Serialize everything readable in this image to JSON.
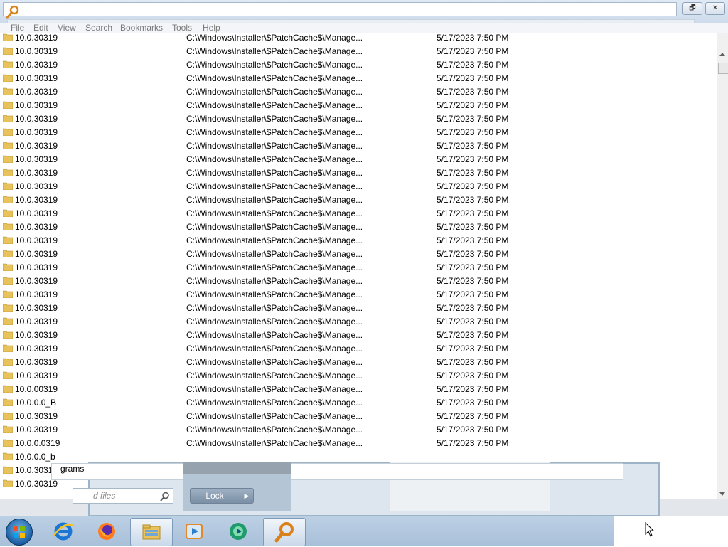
{
  "window": {
    "controls": {
      "restore_label": "🗗",
      "close_label": "✕"
    }
  },
  "menu": [
    {
      "label": "File"
    },
    {
      "label": "Edit"
    },
    {
      "label": "View"
    },
    {
      "label": "Search"
    },
    {
      "label": "Bookmarks"
    },
    {
      "label": "Tools"
    },
    {
      "label": "Help"
    }
  ],
  "rows": [
    {
      "name": "10.0.30319",
      "path": "C:\\Windows\\Installer\\$PatchCache$\\Manage...",
      "date": "5/17/2023 7:50 PM"
    },
    {
      "name": "10.0.30319",
      "path": "C:\\Windows\\Installer\\$PatchCache$\\Manage...",
      "date": "5/17/2023 7:50 PM"
    },
    {
      "name": "10.0.30319",
      "path": "C:\\Windows\\Installer\\$PatchCache$\\Manage...",
      "date": "5/17/2023 7:50 PM"
    },
    {
      "name": "10.0.30319",
      "path": "C:\\Windows\\Installer\\$PatchCache$\\Manage...",
      "date": "5/17/2023 7:50 PM"
    },
    {
      "name": "10.0.30319",
      "path": "C:\\Windows\\Installer\\$PatchCache$\\Manage...",
      "date": "5/17/2023 7:50 PM"
    },
    {
      "name": "10.0.30319",
      "path": "C:\\Windows\\Installer\\$PatchCache$\\Manage...",
      "date": "5/17/2023 7:50 PM"
    },
    {
      "name": "10.0.30319",
      "path": "C:\\Windows\\Installer\\$PatchCache$\\Manage...",
      "date": "5/17/2023 7:50 PM"
    },
    {
      "name": "10.0.30319",
      "path": "C:\\Windows\\Installer\\$PatchCache$\\Manage...",
      "date": "5/17/2023 7:50 PM"
    },
    {
      "name": "10.0.30319",
      "path": "C:\\Windows\\Installer\\$PatchCache$\\Manage...",
      "date": "5/17/2023 7:50 PM"
    },
    {
      "name": "10.0.30319",
      "path": "C:\\Windows\\Installer\\$PatchCache$\\Manage...",
      "date": "5/17/2023 7:50 PM"
    },
    {
      "name": "10.0.30319",
      "path": "C:\\Windows\\Installer\\$PatchCache$\\Manage...",
      "date": "5/17/2023 7:50 PM"
    },
    {
      "name": "10.0.30319",
      "path": "C:\\Windows\\Installer\\$PatchCache$\\Manage...",
      "date": "5/17/2023 7:50 PM"
    },
    {
      "name": "10.0.30319",
      "path": "C:\\Windows\\Installer\\$PatchCache$\\Manage...",
      "date": "5/17/2023 7:50 PM"
    },
    {
      "name": "10.0.30319",
      "path": "C:\\Windows\\Installer\\$PatchCache$\\Manage...",
      "date": "5/17/2023 7:50 PM"
    },
    {
      "name": "10.0.30319",
      "path": "C:\\Windows\\Installer\\$PatchCache$\\Manage...",
      "date": "5/17/2023 7:50 PM"
    },
    {
      "name": "10.0.30319",
      "path": "C:\\Windows\\Installer\\$PatchCache$\\Manage...",
      "date": "5/17/2023 7:50 PM"
    },
    {
      "name": "10.0.30319",
      "path": "C:\\Windows\\Installer\\$PatchCache$\\Manage...",
      "date": "5/17/2023 7:50 PM"
    },
    {
      "name": "10.0.30319",
      "path": "C:\\Windows\\Installer\\$PatchCache$\\Manage...",
      "date": "5/17/2023 7:50 PM"
    },
    {
      "name": "10.0.30319",
      "path": "C:\\Windows\\Installer\\$PatchCache$\\Manage...",
      "date": "5/17/2023 7:50 PM"
    },
    {
      "name": "10.0.30319",
      "path": "C:\\Windows\\Installer\\$PatchCache$\\Manage...",
      "date": "5/17/2023 7:50 PM"
    },
    {
      "name": "10.0.30319",
      "path": "C:\\Windows\\Installer\\$PatchCache$\\Manage...",
      "date": "5/17/2023 7:50 PM"
    },
    {
      "name": "10.0.30319",
      "path": "C:\\Windows\\Installer\\$PatchCache$\\Manage...",
      "date": "5/17/2023 7:50 PM"
    },
    {
      "name": "10.0.30319",
      "path": "C:\\Windows\\Installer\\$PatchCache$\\Manage...",
      "date": "5/17/2023 7:50 PM"
    },
    {
      "name": "10.0.30319",
      "path": "C:\\Windows\\Installer\\$PatchCache$\\Manage...",
      "date": "5/17/2023 7:50 PM"
    },
    {
      "name": "10.0.30319",
      "path": "C:\\Windows\\Installer\\$PatchCache$\\Manage...",
      "date": "5/17/2023 7:50 PM"
    },
    {
      "name": "10.0.30319",
      "path": "C:\\Windows\\Installer\\$PatchCache$\\Manage...",
      "date": "5/17/2023 7:50 PM"
    },
    {
      "name": "10.0.00319",
      "path": "C:\\Windows\\Installer\\$PatchCache$\\Manage...",
      "date": "5/17/2023 7:50 PM"
    },
    {
      "name": "10.0.0.0_B",
      "path": "C:\\Windows\\Installer\\$PatchCache$\\Manage...",
      "date": "5/17/2023 7:50 PM"
    },
    {
      "name": "10.0.30319",
      "path": "C:\\Windows\\Installer\\$PatchCache$\\Manage...",
      "date": "5/17/2023 7:50 PM"
    },
    {
      "name": "10.0.30319",
      "path": "C:\\Windows\\Installer\\$PatchCache$\\Manage...",
      "date": "5/17/2023 7:50 PM"
    },
    {
      "name": "10.0.0.0319",
      "path": "C:\\Windows\\Installer\\$PatchCache$\\Manage...",
      "date": "5/17/2023 7:50 PM"
    },
    {
      "name": "10.0.0.0_b",
      "path": "",
      "date": ""
    },
    {
      "name": "10.0.30319",
      "path": "",
      "date": ""
    },
    {
      "name": "10.0.30319",
      "path": "",
      "date": ""
    }
  ],
  "panel": {
    "label": "grams",
    "search_placeholder": "d files",
    "lock_label": "Lock",
    "lock_arrow": "▶"
  },
  "taskbar": {
    "apps": [
      {
        "icon": "internet-explorer-icon"
      },
      {
        "icon": "firefox-icon"
      },
      {
        "icon": "file-explorer-icon",
        "active": true
      },
      {
        "icon": "media-player-icon"
      },
      {
        "icon": "media-center-icon"
      },
      {
        "icon": "search-magnifier-icon"
      }
    ]
  },
  "colors": {
    "accent": "#b4c5d6",
    "folder": "#e8c25a",
    "menu_text": "#7a7a7a"
  }
}
